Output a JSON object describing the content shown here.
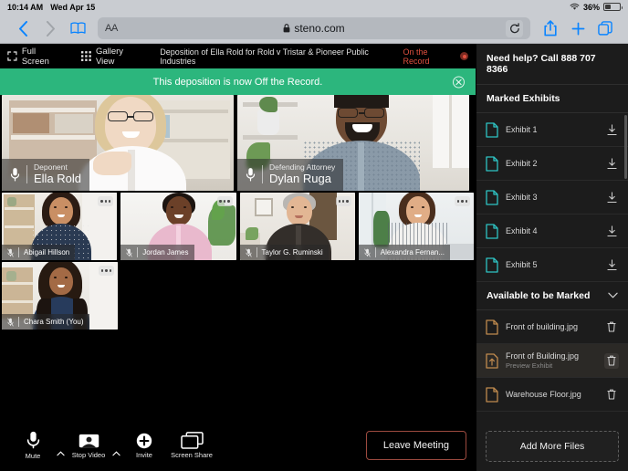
{
  "status_bar": {
    "time": "10:14 AM",
    "date": "Wed Apr 15",
    "wifi_icon": "wifi-icon",
    "battery_percent": "36%",
    "battery_level": 36
  },
  "browser": {
    "back_icon": "chevron-left-icon",
    "forward_icon": "chevron-right-icon",
    "bookmarks_icon": "book-icon",
    "text_size_label": "AA",
    "lock_icon": "lock-icon",
    "url": "steno.com",
    "reload_icon": "reload-icon",
    "share_icon": "share-icon",
    "new_tab_icon": "plus-icon",
    "tabs_icon": "tabs-icon"
  },
  "meeting": {
    "header": {
      "full_screen_label": "Full Screen",
      "full_screen_icon": "fullscreen-icon",
      "gallery_view_label": "Gallery View",
      "gallery_view_icon": "grid-icon",
      "title": "Deposition of Ella Rold for Rold v Tristar & Pioneer Public Industries",
      "record_status": "On the Record",
      "record_icon": "record-dot-icon"
    },
    "banner": {
      "message": "This deposition is now Off the Record.",
      "close_icon": "close-circle-icon",
      "color": "#2cb67d"
    },
    "participants": [
      {
        "name": "Ella Rold",
        "role": "Deponent",
        "size": "big",
        "active": true,
        "mic_icon": "microphone-icon",
        "menu_icon": "more-options-icon"
      },
      {
        "name": "Dylan Ruga",
        "role": "Defending Attorney",
        "size": "big",
        "active": false,
        "mic_icon": "microphone-icon",
        "menu_icon": "more-options-icon"
      },
      {
        "name": "Abigail Hillson",
        "role": "",
        "size": "small",
        "active": false,
        "mic_icon": "microphone-muted-icon",
        "menu_icon": "more-options-icon"
      },
      {
        "name": "Jordan James",
        "role": "",
        "size": "small",
        "active": false,
        "mic_icon": "microphone-muted-icon",
        "menu_icon": "more-options-icon"
      },
      {
        "name": "Taylor G. Ruminski",
        "role": "",
        "size": "small",
        "active": false,
        "mic_icon": "microphone-muted-icon",
        "menu_icon": "more-options-icon"
      },
      {
        "name": "Alexandra Fernan...",
        "role": "",
        "size": "small",
        "active": false,
        "mic_icon": "microphone-muted-icon",
        "menu_icon": "more-options-icon"
      },
      {
        "name": "Chara Smith (You)",
        "role": "",
        "size": "small",
        "active": false,
        "mic_icon": "microphone-muted-icon",
        "menu_icon": "more-options-icon"
      }
    ],
    "controls": [
      {
        "label": "Mute",
        "icon": "microphone-icon",
        "has_caret": true
      },
      {
        "label": "Stop Video",
        "icon": "video-camera-icon",
        "has_caret": true
      },
      {
        "label": "Invite",
        "icon": "add-person-icon",
        "has_caret": false
      },
      {
        "label": "Screen Share",
        "icon": "screen-share-icon",
        "has_caret": false
      }
    ],
    "leave_button": "Leave Meeting",
    "leave_button_color": "#9c4a3f"
  },
  "sidebar": {
    "help_text": "Need help? Call 888 707 8366",
    "marked_section": {
      "title": "Marked Exhibits",
      "items": [
        {
          "name": "Exhibit 1",
          "file_icon": "document-icon",
          "action_icon": "download-icon"
        },
        {
          "name": "Exhibit 2",
          "file_icon": "document-icon",
          "action_icon": "download-icon"
        },
        {
          "name": "Exhibit 3",
          "file_icon": "document-icon",
          "action_icon": "download-icon"
        },
        {
          "name": "Exhibit 4",
          "file_icon": "document-icon",
          "action_icon": "download-icon"
        },
        {
          "name": "Exhibit 5",
          "file_icon": "document-icon",
          "action_icon": "download-icon"
        }
      ],
      "icon_color": "#2ec4c4"
    },
    "available_section": {
      "title": "Available to be Marked",
      "collapse_icon": "chevron-down-icon",
      "items": [
        {
          "name": "Front of building.jpg",
          "sub": "",
          "file_icon": "document-icon",
          "action_icon": "trash-icon",
          "hovered": false
        },
        {
          "name": "Front of Building.jpg",
          "sub": "Preview Exhibit",
          "file_icon": "document-upload-icon",
          "action_icon": "trash-icon",
          "hovered": true
        },
        {
          "name": "Warehouse Floor.jpg",
          "sub": "",
          "file_icon": "document-icon",
          "action_icon": "trash-icon",
          "hovered": false
        }
      ],
      "icon_color": "#c08a4e"
    },
    "add_files_button": "Add More Files"
  }
}
